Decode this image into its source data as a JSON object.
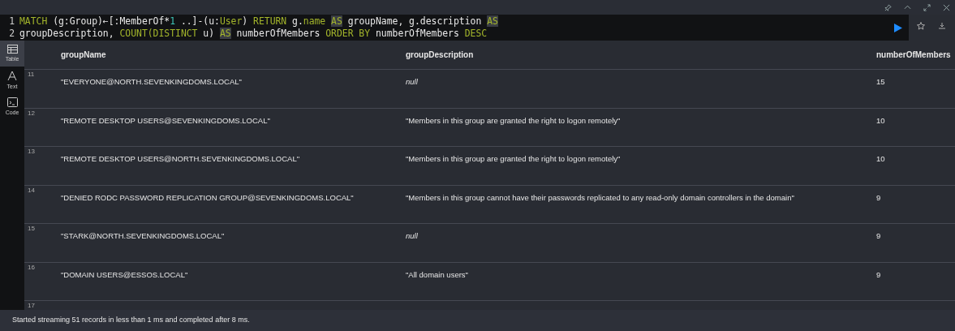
{
  "query": {
    "lines": [
      {
        "number": "1",
        "tokens": [
          {
            "kind": "kw",
            "text": "MATCH"
          },
          {
            "kind": "plain",
            "text": " (g:Group)←[:MemberOf*"
          },
          {
            "kind": "num",
            "text": "1"
          },
          {
            "kind": "plain",
            "text": " ..]-(u:"
          },
          {
            "kind": "kw",
            "text": "User"
          },
          {
            "kind": "plain",
            "text": ") "
          },
          {
            "kind": "kw",
            "text": "RETURN"
          },
          {
            "kind": "plain",
            "text": " g."
          },
          {
            "kind": "kw",
            "text": "name "
          },
          {
            "kind": "hl",
            "text": "AS"
          },
          {
            "kind": "plain",
            "text": " groupName, g.description "
          },
          {
            "kind": "hl",
            "text": "AS"
          }
        ]
      },
      {
        "number": "2",
        "tokens": [
          {
            "kind": "plain",
            "text": "groupDescription, "
          },
          {
            "kind": "kw",
            "text": "COUNT(DISTINCT"
          },
          {
            "kind": "plain",
            "text": " u) "
          },
          {
            "kind": "hl",
            "text": "AS"
          },
          {
            "kind": "plain",
            "text": " numberOfMembers "
          },
          {
            "kind": "kw",
            "text": "ORDER BY"
          },
          {
            "kind": "plain",
            "text": " numberOfMembers "
          },
          {
            "kind": "kw",
            "text": "DESC"
          }
        ]
      }
    ]
  },
  "views": [
    {
      "label": "Table",
      "kind": "table",
      "selected": true
    },
    {
      "label": "Text",
      "kind": "text",
      "selected": false
    },
    {
      "label": "Code",
      "kind": "code",
      "selected": false
    }
  ],
  "table": {
    "columns": [
      "groupName",
      "groupDescription",
      "numberOfMembers"
    ],
    "rows": [
      {
        "index": "11",
        "cells": [
          {
            "text": "\"EVERYONE@NORTH.SEVENKINGDOMS.LOCAL\"",
            "null": false
          },
          {
            "text": "null",
            "null": true
          },
          {
            "text": "15",
            "null": false
          }
        ]
      },
      {
        "index": "12",
        "cells": [
          {
            "text": "\"REMOTE DESKTOP USERS@SEVENKINGDOMS.LOCAL\"",
            "null": false
          },
          {
            "text": "\"Members in this group are granted the right to logon remotely\"",
            "null": false
          },
          {
            "text": "10",
            "null": false
          }
        ]
      },
      {
        "index": "13",
        "cells": [
          {
            "text": "\"REMOTE DESKTOP USERS@NORTH.SEVENKINGDOMS.LOCAL\"",
            "null": false
          },
          {
            "text": "\"Members in this group are granted the right to logon remotely\"",
            "null": false
          },
          {
            "text": "10",
            "null": false
          }
        ]
      },
      {
        "index": "14",
        "cells": [
          {
            "text": "\"DENIED RODC PASSWORD REPLICATION GROUP@SEVENKINGDOMS.LOCAL\"",
            "null": false
          },
          {
            "text": "\"Members in this group cannot have their passwords replicated to any read-only domain controllers in the domain\"",
            "null": false
          },
          {
            "text": "9",
            "null": false
          }
        ]
      },
      {
        "index": "15",
        "cells": [
          {
            "text": "\"STARK@NORTH.SEVENKINGDOMS.LOCAL\"",
            "null": false
          },
          {
            "text": "null",
            "null": true
          },
          {
            "text": "9",
            "null": false
          }
        ]
      },
      {
        "index": "16",
        "cells": [
          {
            "text": "\"DOMAIN USERS@ESSOS.LOCAL\"",
            "null": false
          },
          {
            "text": "\"All domain users\"",
            "null": false
          },
          {
            "text": "9",
            "null": false
          }
        ]
      },
      {
        "index": "17",
        "cells": []
      }
    ]
  },
  "status_bar": "Started streaming 51 records in less than 1 ms and completed after 8 ms."
}
